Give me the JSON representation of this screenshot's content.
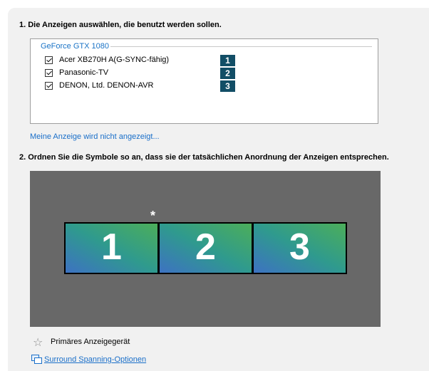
{
  "section1": {
    "heading": "1. Die Anzeigen auswählen, die benutzt werden sollen.",
    "gpu_name": "GeForce GTX 1080",
    "displays": [
      {
        "name": "Acer XB270H A(G-SYNC-fähig)",
        "number": "1",
        "checked": true
      },
      {
        "name": "Panasonic-TV",
        "number": "2",
        "checked": true
      },
      {
        "name": "DENON, Ltd. DENON-AVR",
        "number": "3",
        "checked": true
      }
    ],
    "missing_link": "Meine Anzeige wird nicht angezeigt..."
  },
  "section2": {
    "heading": "2. Ordnen Sie die Symbole so an, dass sie der tatsächlichen Anordnung der Anzeigen entsprechen.",
    "monitors": [
      {
        "number": "1",
        "primary_marker": "*"
      },
      {
        "number": "2"
      },
      {
        "number": "3"
      }
    ]
  },
  "legend": {
    "primary_label": "Primäres Anzeigegerät",
    "star_icon": "star-outline-icon"
  },
  "surround_link": "Surround Spanning-Optionen",
  "colors": {
    "panel_bg": "#f1f1f1",
    "link": "#1a6fc9",
    "badge_bg": "#124e66",
    "canvas_bg": "#686868",
    "monitor_gradient_start": "#3d72c2",
    "monitor_gradient_end": "#4cae5a"
  }
}
